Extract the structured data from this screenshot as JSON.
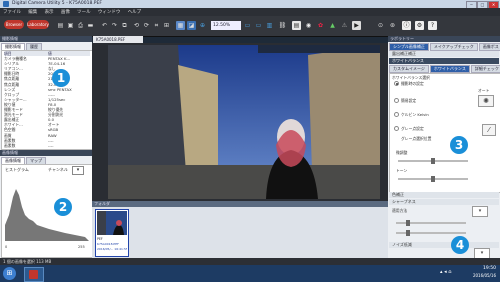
{
  "app": {
    "title": "Digital Camera Utility 5 - K75A0018.PEF"
  },
  "window": {
    "min": "─",
    "max": "□",
    "close": "✕"
  },
  "menu": [
    "ファイル",
    "編集",
    "表示",
    "画像",
    "ツール",
    "ウィンドウ",
    "ヘルプ"
  ],
  "toolbar": {
    "browser": "Browser",
    "laboratory": "Laboratory",
    "zoom": "12.50%"
  },
  "left_top": {
    "title": "撮影情報",
    "tabs": [
      "撮影情報",
      "履歴"
    ],
    "header": [
      "項目",
      "値"
    ],
    "rows": [
      [
        "カメラ機種名",
        "PENTAX K..."
      ],
      [
        "シリアル",
        "7E-04-16"
      ],
      [
        "リアコン...",
        "なし"
      ],
      [
        "撮影日時",
        "2016/05/..."
      ],
      [
        "焦点距離",
        "21.0mm"
      ],
      [
        "焦点距離",
        "32.0mm"
      ],
      [
        "レンズ",
        "smc PENTAX"
      ],
      [
        "クロップ",
        "-----"
      ],
      [
        "シャッター...",
        "1/125sec"
      ],
      [
        "絞り値",
        "F8.0"
      ],
      [
        "撮影モード",
        "絞り優先"
      ],
      [
        "測光モード",
        "分割測光"
      ],
      [
        "露出補正",
        "0.0"
      ],
      [
        "ホワイト...",
        "オート"
      ],
      [
        "色空間",
        "sRGB"
      ],
      [
        "画質",
        "RAW"
      ],
      [
        "画素数",
        "----"
      ],
      [
        "画素数",
        "----"
      ]
    ]
  },
  "left_bottom": {
    "title": "画像情報",
    "tabs": [
      "画像情報",
      "マップ"
    ],
    "histogram_label": "ヒストグラム",
    "channel_label": "チャンネル",
    "axis_min": "0",
    "axis_max": "255"
  },
  "doc": {
    "tab": "K75A0018.PEF"
  },
  "filmstrip": {
    "title": "フォルダ",
    "thumb_name": "PEF",
    "thumb_info1": "K75A0018.PEF",
    "thumb_info2": "2016/05/... 16:41:55"
  },
  "right": {
    "title": "ラボラトリー",
    "tabs": [
      "シンプル画像補正",
      "メイクアップチェック",
      "画像ポスト"
    ],
    "section1": "露出補正補正",
    "section2": "ホワイトバランス",
    "subtabs": [
      "カスタムイメージ",
      "ホワイトバランス",
      "詳細チェック"
    ],
    "wb_title": "ホワイトバランス選択",
    "wb_option_selected": "撮影時の設定",
    "opt_auto": "オート",
    "opt_direct": "簡易設定",
    "opt_kelvin": "ケルビン Kelvin",
    "opt_gray": "グレー点設定",
    "opt_gray_sub": "グレー点選択位置",
    "fine_adjust": "微調整",
    "tone": "トーン",
    "section3": "色補正",
    "section4": "シャープネス",
    "sharp_label": "適用方法",
    "section5": "ノイズ低減"
  },
  "status": {
    "text": "1 個の画像を選択 113 MB"
  },
  "taskbar": {
    "time": "19:50",
    "date": "2016/05/16"
  },
  "badges": [
    "1",
    "2",
    "3",
    "4"
  ],
  "colors": {
    "badge": "#1a8fd8",
    "accent_red": "#c0362c",
    "histogram": "#777777"
  }
}
